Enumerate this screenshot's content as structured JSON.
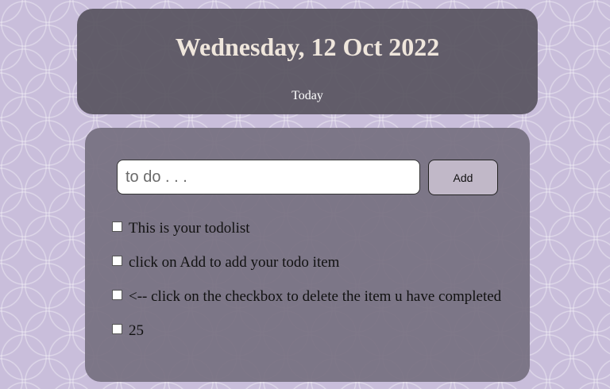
{
  "header": {
    "date": "Wednesday, 12 Oct 2022",
    "subtitle": "Today"
  },
  "todo": {
    "input_placeholder": "to do . . .",
    "add_label": "Add",
    "items": [
      {
        "text": "This is your todolist",
        "checked": false
      },
      {
        "text": "click on Add to add your todo item",
        "checked": false
      },
      {
        "text": "<-- click on the checkbox to delete the item u have completed",
        "checked": false
      },
      {
        "text": "25",
        "checked": false
      }
    ]
  },
  "colors": {
    "background": "#c9bedb",
    "header_card": "#5a5662",
    "todo_card": "#767080",
    "add_button": "#c1b8c8"
  }
}
